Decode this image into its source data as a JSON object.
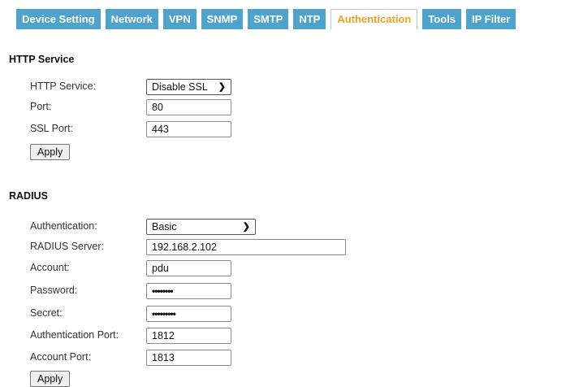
{
  "tabs": [
    {
      "label": "Device Setting",
      "active": false
    },
    {
      "label": "Network",
      "active": false
    },
    {
      "label": "VPN",
      "active": false
    },
    {
      "label": "SNMP",
      "active": false
    },
    {
      "label": "SMTP",
      "active": false
    },
    {
      "label": "NTP",
      "active": false
    },
    {
      "label": "Authentication",
      "active": true
    },
    {
      "label": "Tools",
      "active": false
    },
    {
      "label": "IP Filter",
      "active": false
    }
  ],
  "colors": {
    "tab_bg": "#4da3cc",
    "tab_active_text": "#f0a020"
  },
  "http": {
    "title": "HTTP Service",
    "service_label": "HTTP Service:",
    "service_value": "Disable SSL",
    "port_label": "Port:",
    "port_value": "80",
    "ssl_port_label": "SSL Port:",
    "ssl_port_value": "443",
    "apply_label": "Apply"
  },
  "radius": {
    "title": "RADIUS",
    "auth_label": "Authentication:",
    "auth_value": "Basic",
    "server_label": "RADIUS Server:",
    "server_value": "192.168.2.102",
    "account_label": "Account:",
    "account_value": "pdu",
    "password_label": "Password:",
    "password_value": "••••••••",
    "secret_label": "Secret:",
    "secret_value": "•••••••••",
    "auth_port_label": "Authentication Port:",
    "auth_port_value": "1812",
    "account_port_label": "Account Port:",
    "account_port_value": "1813",
    "apply_label": "Apply"
  }
}
